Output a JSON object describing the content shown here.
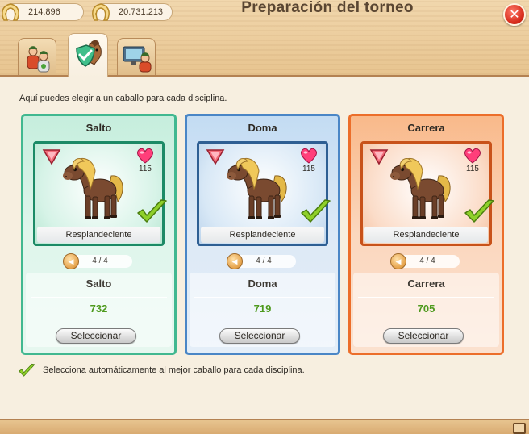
{
  "header": {
    "title": "Preparación del torneo",
    "horseshoes": "214.896",
    "money": "20.731.213",
    "close_icon": "close-icon"
  },
  "tabs": [
    {
      "icon": "riders-icon"
    },
    {
      "icon": "horse-shield-icon",
      "active": true
    },
    {
      "icon": "monitor-trainer-icon"
    }
  ],
  "main": {
    "intro": "Aquí puedes elegir a un caballo para cada disciplina.",
    "cards": [
      {
        "discipline": "Salto",
        "horse_name": "Resplandeciente",
        "hearts": "115",
        "page": "4 / 4",
        "stat_label": "Salto",
        "stat_value": "732",
        "button": "Seleccionar"
      },
      {
        "discipline": "Doma",
        "horse_name": "Resplandeciente",
        "hearts": "115",
        "page": "4 / 4",
        "stat_label": "Doma",
        "stat_value": "719",
        "button": "Seleccionar"
      },
      {
        "discipline": "Carrera",
        "horse_name": "Resplandeciente",
        "hearts": "115",
        "page": "4 / 4",
        "stat_label": "Carrera",
        "stat_value": "705",
        "button": "Seleccionar"
      }
    ],
    "auto_select_label": "Selecciona automáticamente al mejor caballo para cada disciplina.",
    "auto_select_checked": true
  },
  "colors": {
    "salto": "#41b890",
    "doma": "#4a86c6",
    "carrera": "#ec6e2a",
    "stat_value": "#4e9a1e"
  }
}
